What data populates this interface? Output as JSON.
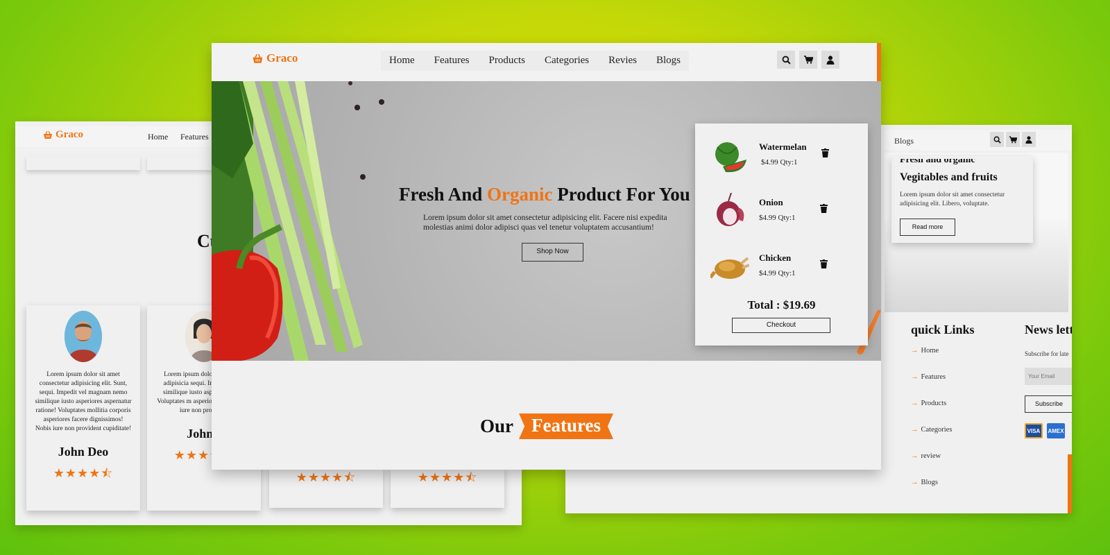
{
  "colors": {
    "accent": "#f07414",
    "panel_bg": "#f0f0f0",
    "background": "#b9d70a"
  },
  "brand": {
    "name": "Graco",
    "icon": "basket-icon"
  },
  "main": {
    "nav": [
      "Home",
      "Features",
      "Products",
      "Categories",
      "Revies",
      "Blogs"
    ],
    "icons": [
      "search-icon",
      "cart-icon",
      "user-icon"
    ],
    "hero": {
      "title_before": "Fresh And",
      "title_accent": "Organic",
      "title_after": "Product For You",
      "text": "Lorem ipsum dolor sit amet consectetur adipisicing elit. Facere nisi expedita molestias animi dolor adipisci quas vel tenetur voluptatem accusantium!",
      "button": "Shop Now"
    },
    "cart": {
      "items": [
        {
          "name": "Watermelan",
          "price": "$4.99 Qty:1"
        },
        {
          "name": "Onion",
          "price": "$4.99 Qty:1"
        },
        {
          "name": "Chicken",
          "price": "$4.99 Qty:1"
        }
      ],
      "total": "Total : $19.69",
      "checkout": "Checkout"
    },
    "features_heading": {
      "plain": "Our",
      "badge": "Features"
    }
  },
  "left": {
    "nav": [
      "Home",
      "Features"
    ],
    "heading_partial": "Cu",
    "reviews": [
      {
        "text": "Lorem ipsum dolor sit amet consectetur adipisicing elit. Sunt, sequi. Impedit vel magnam nemo similique iusto asperiores aspernatur ratione! Voluptates mollitia corporis asperiores facere dignissimos! Nobis iure non provident cupiditate!",
        "name": "John Deo",
        "stars": "★★★★⯪"
      },
      {
        "text": "Lorem ipsum dolo consectetur adipisicia sequi. Impedit vel m similique iusto asperio ratione! Voluptates m asperiores facere dign iure non provident",
        "name": "John I",
        "stars": "★★★★⯪"
      }
    ],
    "extra_stars": [
      "★★★★⯪",
      "★★★★⯪"
    ]
  },
  "right": {
    "nav_item": "Blogs",
    "blog": {
      "partial_title": "Fresh and organic",
      "title": "Vegitables and fruits",
      "text": "Lorem ipsum dolor sit amet consectetur adipisicing elit. Libero, voluptate.",
      "button": "Read more"
    },
    "quick_links": {
      "title": "quick Links",
      "items": [
        "Home",
        "Features",
        "Products",
        "Categories",
        "review",
        "Blogs"
      ]
    },
    "newsletter": {
      "title": "News lett",
      "text": "Subscribe for late",
      "placeholder": "Your Email",
      "button": "Subscribe",
      "cards": [
        "VISA",
        "AMEX"
      ]
    }
  }
}
